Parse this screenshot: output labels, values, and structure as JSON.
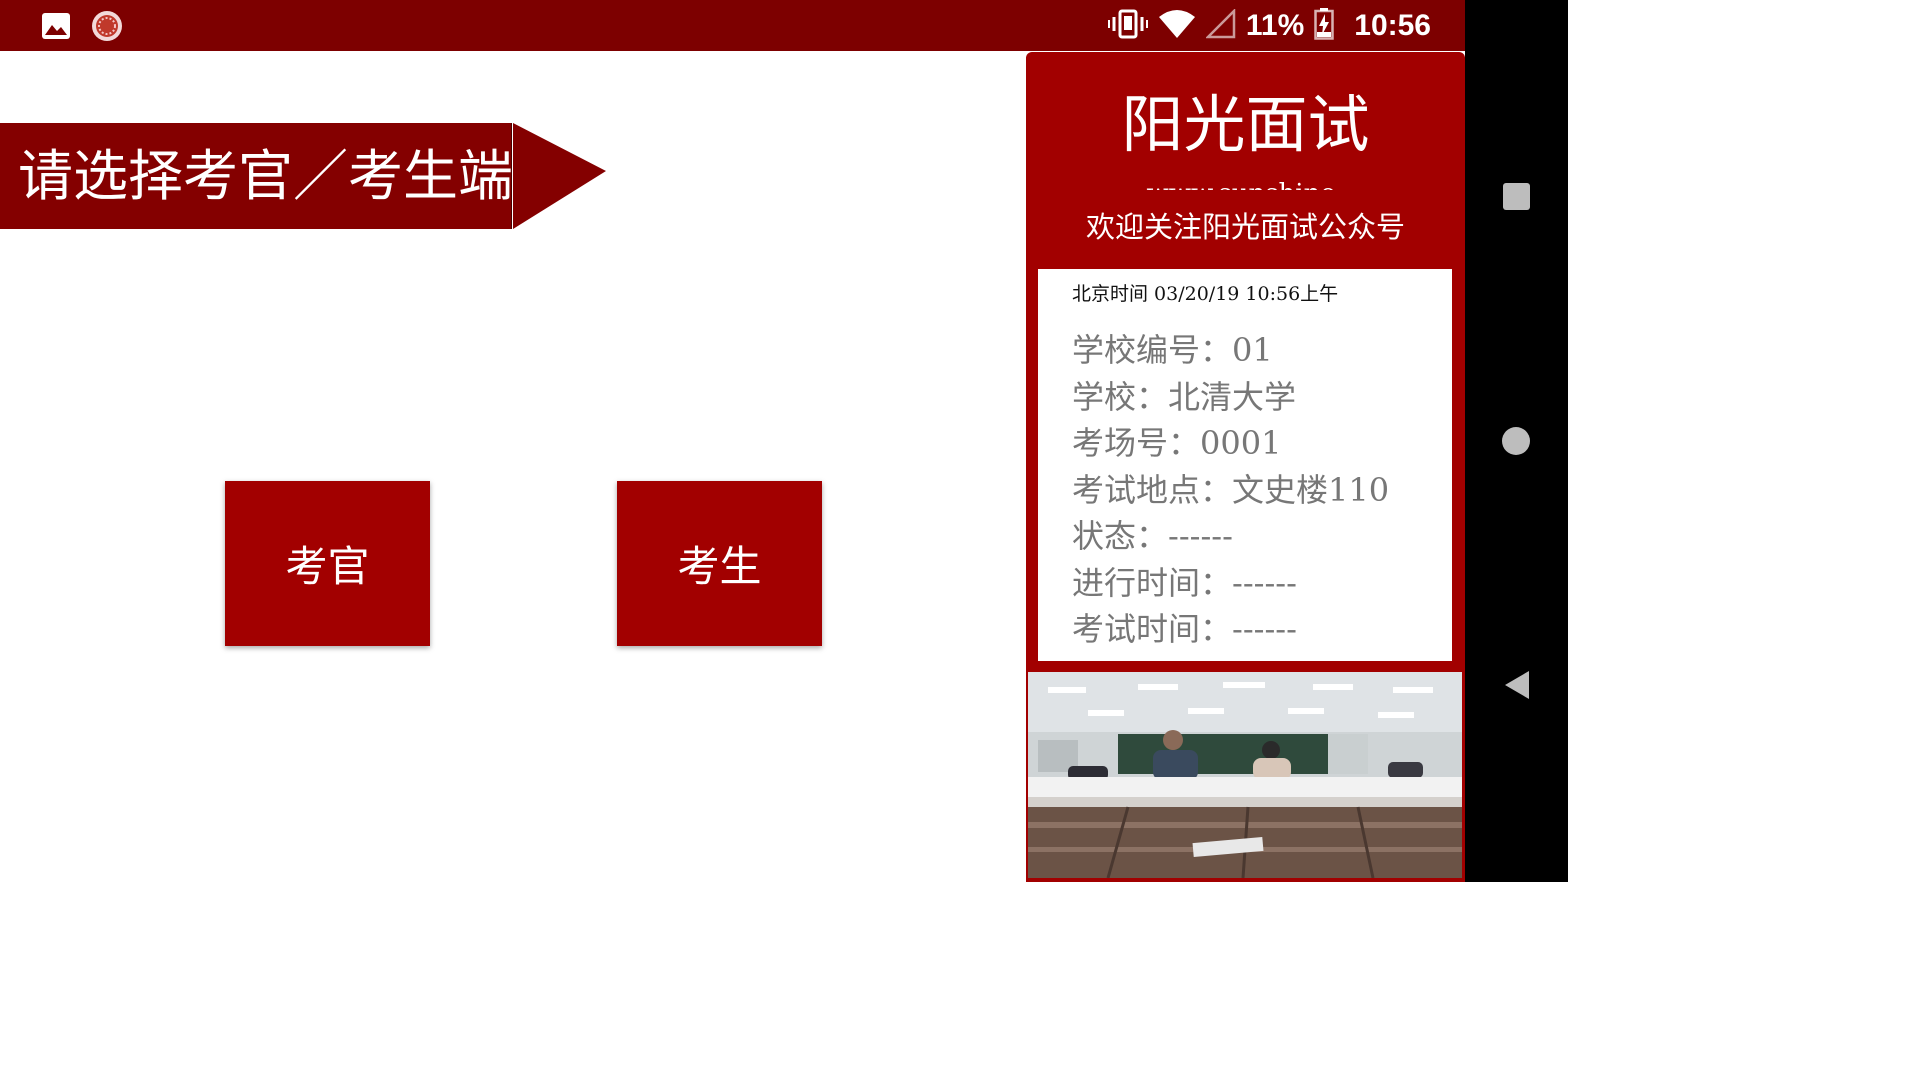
{
  "status_bar": {
    "battery_percent": "11%",
    "time": "10:56"
  },
  "header": {
    "title": "请选择考官／考生端"
  },
  "buttons": {
    "examiner_label": "考官",
    "student_label": "考生"
  },
  "panel": {
    "title": "阳光面试",
    "url": "www.sunshine-",
    "welcome": "欢迎关注阳光面试公众号",
    "beijing_time": "北京时间 03/20/19 10:56上午",
    "info": [
      "学校编号：01",
      "学校：北清大学",
      "考场号：0001",
      "考试地点：文史楼110",
      "状态：------",
      "进行时间：------",
      "考试时间：------"
    ]
  },
  "colors": {
    "status_bar_bg": "#7d0000",
    "header_bg": "#840000",
    "button_bg": "#a20000",
    "panel_bg": "#a20000"
  }
}
